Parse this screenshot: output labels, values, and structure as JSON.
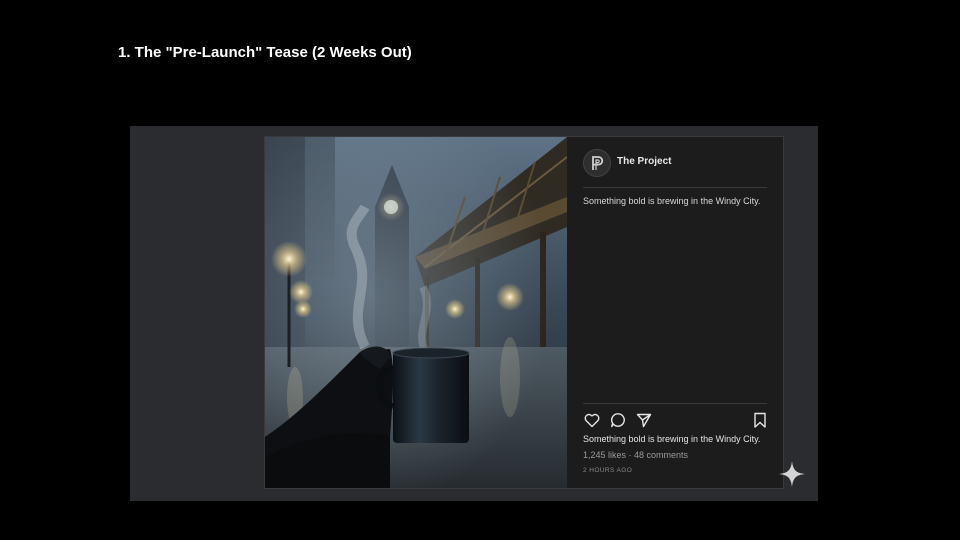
{
  "slide": {
    "title": "1. The \"Pre-Launch\" Tease (2 Weeks Out)"
  },
  "post": {
    "account": {
      "name": "The Project",
      "avatar_icon": "stylized-p-logo"
    },
    "caption": "Something bold is brewing in the Windy City.",
    "caption_footer": "Something bold is brewing in the Windy City.",
    "likes": "1,245 likes",
    "separator": " · ",
    "comments": "48 comments",
    "timestamp": "2 HOURS AGO",
    "photo_alt": "Gloved hand holding a steaming black mug on a foggy Chicago street under the elevated train tracks at night, clock tower in the background",
    "icons": [
      "heart-icon",
      "comment-icon",
      "share-icon",
      "bookmark-icon"
    ]
  },
  "decor": {
    "sparkle_icon": "sparkle-icon"
  },
  "colors": {
    "background": "#000000",
    "panel": "#2a2c2f",
    "card": "#1c1c1c",
    "text": "#e4e4e4",
    "muted": "#9a9a9a"
  }
}
